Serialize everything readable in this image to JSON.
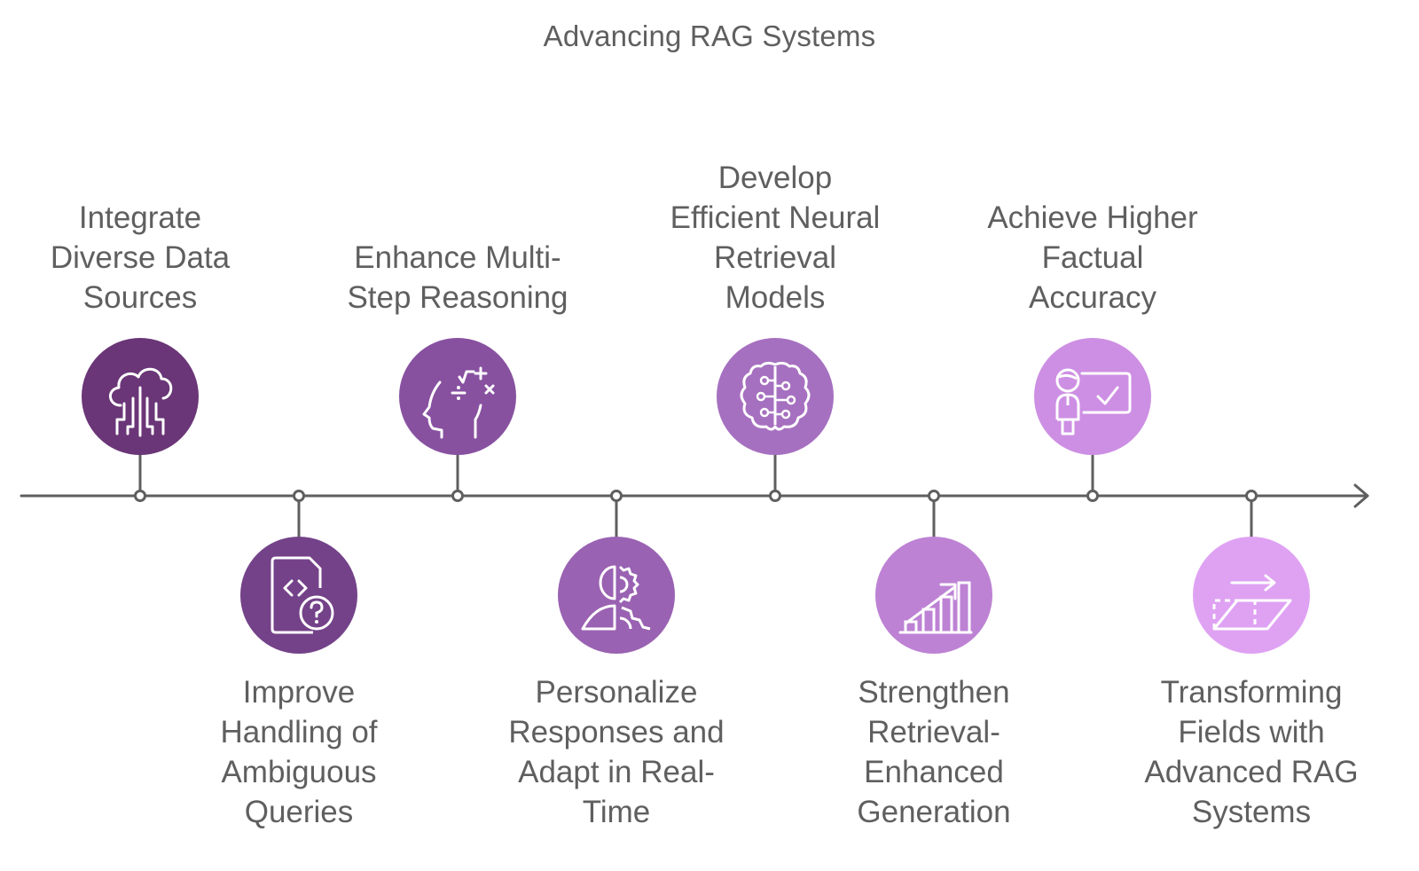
{
  "title": "Advancing RAG Systems",
  "timeline": {
    "line_color": "#5f5f5f",
    "steps": [
      {
        "label": "Integrate Diverse Data Sources",
        "lines": [
          "Integrate",
          "Diverse Data",
          "Sources"
        ],
        "position": "top",
        "icon": "cloud-circuit-icon",
        "color": "#6a3677"
      },
      {
        "label": "Improve Handling of Ambiguous Queries",
        "lines": [
          "Improve",
          "Handling of",
          "Ambiguous",
          "Queries"
        ],
        "position": "bottom",
        "icon": "code-document-question-icon",
        "color": "#744289"
      },
      {
        "label": "Enhance Multi-Step Reasoning",
        "lines": [
          "Enhance Multi-",
          "Step Reasoning"
        ],
        "position": "top",
        "icon": "head-math-icon",
        "color": "#8851a0"
      },
      {
        "label": "Personalize Responses and Adapt in Real-Time",
        "lines": [
          "Personalize",
          "Responses and",
          "Adapt in Real-",
          "Time"
        ],
        "position": "bottom",
        "icon": "person-gear-icon",
        "color": "#9a62b2"
      },
      {
        "label": "Develop Efficient Neural Retrieval Models",
        "lines": [
          "Develop",
          "Efficient Neural",
          "Retrieval",
          "Models"
        ],
        "position": "top",
        "icon": "brain-circuit-icon",
        "color": "#a670c0"
      },
      {
        "label": "Strengthen Retrieval-Enhanced Generation",
        "lines": [
          "Strengthen",
          "Retrieval-",
          "Enhanced",
          "Generation"
        ],
        "position": "bottom",
        "icon": "growth-chart-icon",
        "color": "#bd82d4"
      },
      {
        "label": "Achieve Higher Factual Accuracy",
        "lines": [
          "Achieve Higher",
          "Factual",
          "Accuracy"
        ],
        "position": "top",
        "icon": "presenter-check-icon",
        "color": "#cd8fe3"
      },
      {
        "label": "Transforming Fields with Advanced RAG Systems",
        "lines": [
          "Transforming",
          "Fields with",
          "Advanced RAG",
          "Systems"
        ],
        "position": "bottom",
        "icon": "transform-shape-icon",
        "color": "#dfa2f3"
      }
    ]
  }
}
